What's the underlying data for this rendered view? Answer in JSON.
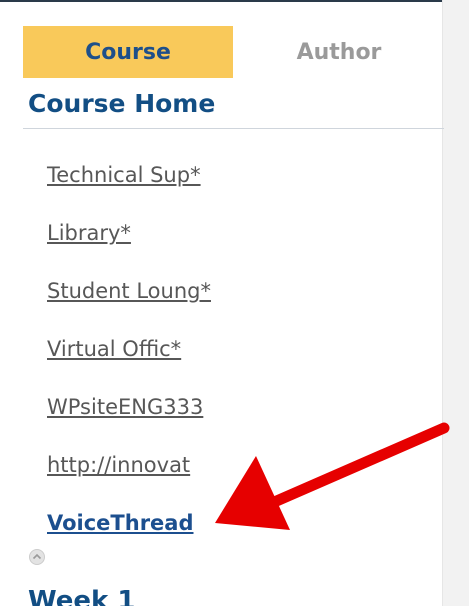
{
  "tabs": {
    "course_label": "Course",
    "author_label": "Author"
  },
  "section": {
    "title": "Course Home"
  },
  "nav_links": [
    "Technical Sup*",
    "Library*",
    "Student Loung*",
    "Virtual Offic*",
    "WPsiteENG333",
    "http://innovat",
    "VoiceThread"
  ],
  "week": {
    "title": "Week 1"
  },
  "icons": {
    "collapse": "chevron-up-icon",
    "annotation": "red-arrow-annotation"
  },
  "colors": {
    "active_tab_bg": "#f9c95a",
    "heading_blue": "#124e84",
    "annotation_red": "#e60000"
  }
}
